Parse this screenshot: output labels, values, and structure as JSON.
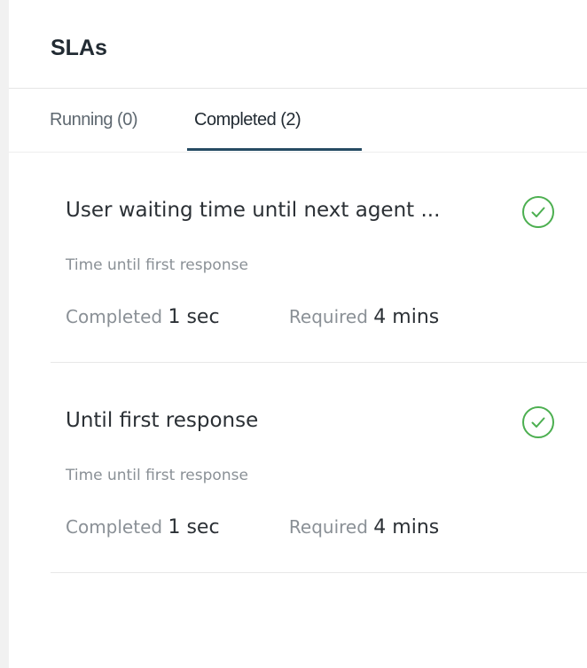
{
  "panel": {
    "title": "SLAs"
  },
  "tabs": [
    {
      "label": "Running (0)",
      "active": false
    },
    {
      "label": "Completed (2)",
      "active": true
    }
  ],
  "slas": [
    {
      "name": "User waiting time until next agent ...",
      "description": "Time until first response",
      "completed_label": "Completed",
      "completed_value": "1 sec",
      "required_label": "Required",
      "required_value": "4 mins",
      "status_icon": "check-circle-icon"
    },
    {
      "name": "Until first response",
      "description": "Time until first response",
      "completed_label": "Completed",
      "completed_value": "1 sec",
      "required_label": "Required",
      "required_value": "4 mins",
      "status_icon": "check-circle-icon"
    }
  ],
  "colors": {
    "success": "#4caf50",
    "tab_underline": "#264b63"
  }
}
